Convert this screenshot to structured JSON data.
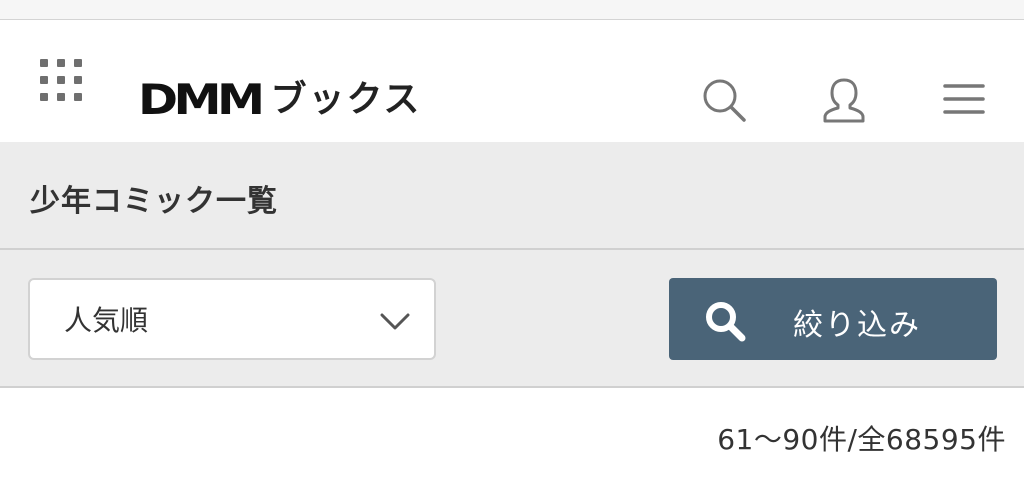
{
  "header": {
    "apps_icon": "grid-apps-icon",
    "logo_mark": "DMM",
    "logo_sub": "ブックス",
    "icons": {
      "search": "search-icon",
      "account": "user-icon",
      "menu": "hamburger-menu-icon"
    }
  },
  "page": {
    "title": "少年コミック一覧"
  },
  "filters": {
    "sort_selected": "人気順",
    "filter_button_label": "絞り込み",
    "colors": {
      "filter_button_bg": "#4a6478",
      "band_bg": "#ececec"
    }
  },
  "results": {
    "count_text": "61〜90件/全68595件"
  }
}
